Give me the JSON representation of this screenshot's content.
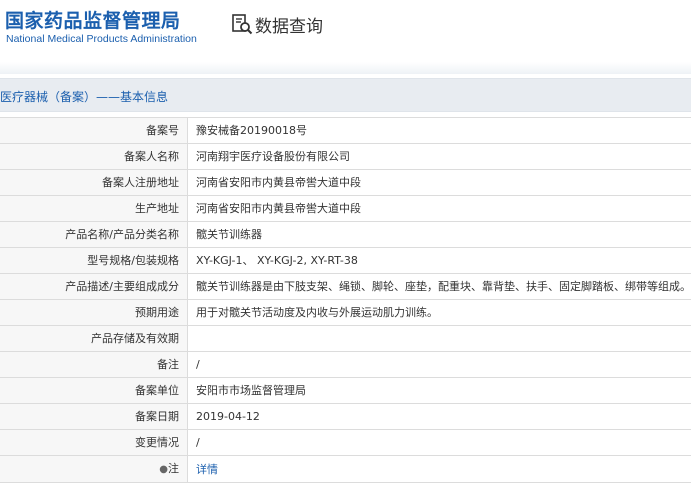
{
  "header": {
    "logo_cn": "国家药品监督管理局",
    "logo_en": "National Medical Products Administration",
    "query_label": "数据查询"
  },
  "section": {
    "title": "医疗器械（备案）——基本信息"
  },
  "rows": [
    {
      "label": "备案号",
      "value": "豫安械备20190018号"
    },
    {
      "label": "备案人名称",
      "value": "河南翔宇医疗设备股份有限公司"
    },
    {
      "label": "备案人注册地址",
      "value": "河南省安阳市内黄县帝喾大道中段"
    },
    {
      "label": "生产地址",
      "value": "河南省安阳市内黄县帝喾大道中段"
    },
    {
      "label": "产品名称/产品分类名称",
      "value": "髋关节训练器"
    },
    {
      "label": "型号规格/包装规格",
      "value": "XY-KGJ-1、 XY-KGJ-2, XY-RT-38"
    },
    {
      "label": "产品描述/主要组成成分",
      "value": "髋关节训练器是由下肢支架、绳锁、脚轮、座垫，配重块、靠背垫、扶手、固定脚踏板、绑带等组成。"
    },
    {
      "label": "预期用途",
      "value": "用于对髋关节活动度及内收与外展运动肌力训练。"
    },
    {
      "label": "产品存储及有效期",
      "value": ""
    },
    {
      "label": "备注",
      "value": "/"
    },
    {
      "label": "备案单位",
      "value": "安阳市市场监督管理局"
    },
    {
      "label": "备案日期",
      "value": "2019-04-12"
    },
    {
      "label": "变更情况",
      "value": "/"
    },
    {
      "label": "注",
      "value": "详情",
      "pin": "●"
    }
  ],
  "colors": {
    "brand_blue": "#1b5fae",
    "label_bg": "#f7f7f7",
    "section_bg": "#e8ecf1"
  },
  "icons": {
    "query": "document-search-icon"
  }
}
